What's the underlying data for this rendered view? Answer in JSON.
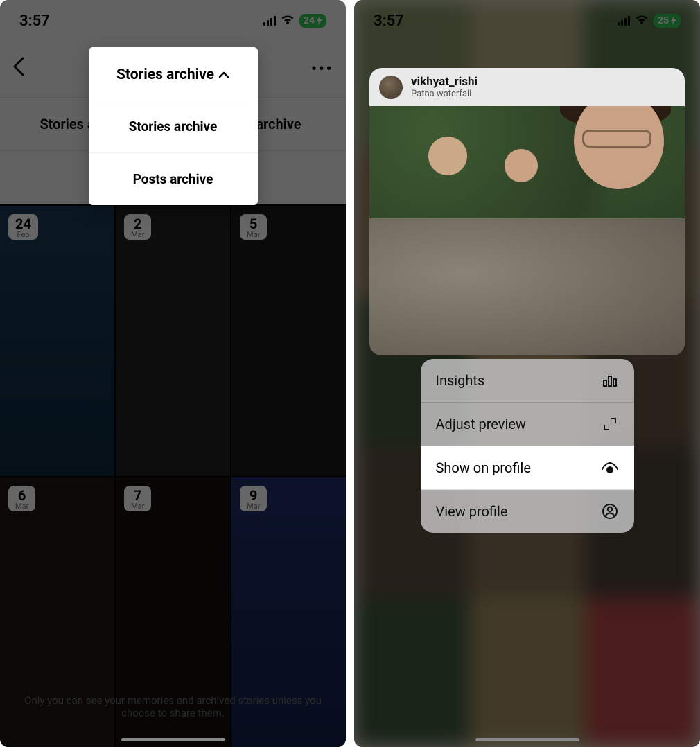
{
  "left": {
    "status": {
      "time": "3:57",
      "battery": "24"
    },
    "popover": {
      "title": "Stories archive",
      "option_stories": "Stories archive",
      "option_posts": "Posts archive"
    },
    "sections": {
      "live": "Live archive"
    },
    "grid": [
      {
        "day": "24",
        "month": "Feb"
      },
      {
        "day": "2",
        "month": "Mar"
      },
      {
        "day": "5",
        "month": "Mar"
      },
      {
        "day": "6",
        "month": "Mar"
      },
      {
        "day": "7",
        "month": "Mar"
      },
      {
        "day": "9",
        "month": "Mar"
      }
    ],
    "footer": "Only you can see your memories and archived stories unless you choose to share them."
  },
  "right": {
    "status": {
      "time": "3:57",
      "battery": "25"
    },
    "post": {
      "username": "vikhyat_rishi",
      "location": "Patna waterfall"
    },
    "menu": {
      "insights": "Insights",
      "adjust": "Adjust preview",
      "show": "Show on profile",
      "view": "View profile"
    }
  }
}
